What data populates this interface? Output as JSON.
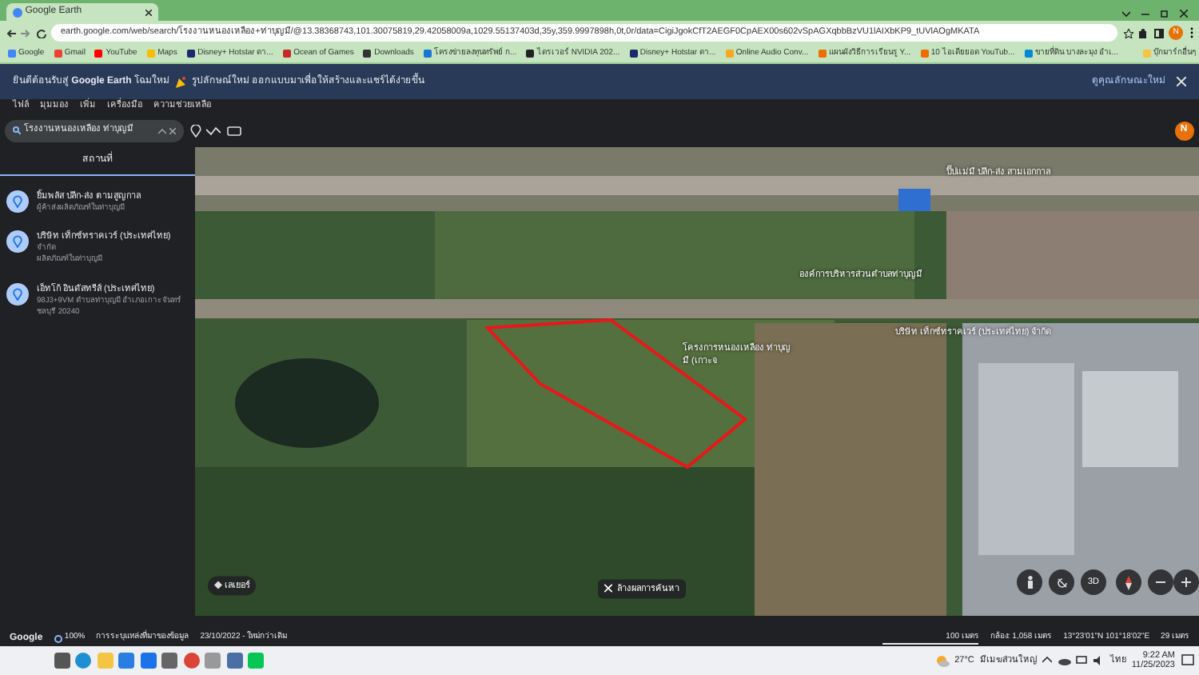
{
  "browser": {
    "tab_title": "Google Earth",
    "url": "earth.google.com/web/search/โรงงานหนองเหลือง+ท่าบุญมี/@13.38368743,101.30075819,29.42058009a,1029.55137403d,35y,359.9997898h,0t,0r/data=CigiJgokCfT2AEGF0CpAEX00s602vSpAGXqbbBzVU1lAIXbKP9_tUVlAOgMKATA",
    "profile_initial": "N",
    "bookmarks": [
      {
        "label": "Google",
        "color": "#4285f4"
      },
      {
        "label": "Gmail",
        "color": "#ea4335"
      },
      {
        "label": "YouTube",
        "color": "#ff0000"
      },
      {
        "label": "Maps",
        "color": "#fbbc04"
      },
      {
        "label": "Disney+ Hotstar ดา...",
        "color": "#1a2a6c"
      },
      {
        "label": "Ocean of Games",
        "color": "#c62828"
      },
      {
        "label": "Downloads",
        "color": "#333333"
      },
      {
        "label": "โครงข่ายลงทุนทรัพย์ ก...",
        "color": "#1976d2"
      },
      {
        "label": "ไดรเวอร์ NVIDIA 202...",
        "color": "#222222"
      },
      {
        "label": "Disney+ Hotstar ดา...",
        "color": "#1a2a6c"
      },
      {
        "label": "Online Audio Conv...",
        "color": "#f9a825"
      },
      {
        "label": "แผนผังวิธีการเรียนรู Y...",
        "color": "#ef6c00"
      },
      {
        "label": "10 ไอเดียยอด YouTub...",
        "color": "#ef6c00"
      },
      {
        "label": "ขายที่ดิน บางละมุง อำเ...",
        "color": "#0288d1"
      }
    ],
    "other_bookmarks": "บุ๊กมาร์กอื่นๆ"
  },
  "banner": {
    "welcome": "ยินดีต้อนรับสู่ **Google Earth** โฉมใหม่",
    "feature": "รูปลักษณ์ใหม่ ออกแบบมาเพื่อให้สร้างและแชร์ได้ง่ายขึ้น",
    "link": "ดูคุณลักษณะใหม่"
  },
  "menu": [
    "ไฟล์",
    "มุมมอง",
    "เพิ่ม",
    "เครื่องมือ",
    "ความช่วยเหลือ"
  ],
  "search": {
    "value": "โรงงานหนองเหลือง ท่าบุญมี"
  },
  "earth_profile_initial": "N",
  "sidebar": {
    "heading": "สถานที่",
    "places": [
      {
        "name": "ยิ้มพลัส ปลีก-ส่ง ตามสูญกาล",
        "lines": [
          "ผู้ค้าส่งผลิตภัณฑ์ในท่าบุญมี"
        ]
      },
      {
        "name": "บริษัท เท็กซ์ทราคเวร์ (ประเทศไทย)",
        "lines": [
          "จำกัด",
          "ผลิตภัณฑ์ในท่าบุญมี"
        ]
      },
      {
        "name": "เอ็ทโก้ อินดัสทรีส์ (ประเทศไทย)",
        "lines": [
          "98J3+9VM ตำบลท่าบุญมี อำเภอเกาะจันทร์",
          "ชลบุรี 20240"
        ]
      }
    ]
  },
  "map": {
    "labels": [
      "ปิ๊ปแม่มี ปลีก-ส่ง สามเอกกาล",
      "องค์การบริหารส่วนตำบลท่าบุญมี",
      "โครงการหนองเหลือง ท่าบุญมี (เกาะจ",
      "บริษัท เท็กซ์ทราคเวร์ (ประเทศไทย) จำกัด"
    ],
    "layers_button": "เลเยอร์",
    "clear_chip": "ล้างผลการค้นหา",
    "view_3d": "3D"
  },
  "status_bar": {
    "brand": "Google",
    "zoom": "100%",
    "attribution": "การระบุแหล่งที่มาของข้อมูล",
    "date": "23/10/2022 - ใหม่กว่าเดิม",
    "scale": "100 เมตร",
    "camera": "กล้อง: 1,058 เมตร",
    "coords": "13°23'01\"N 101°18'02\"E",
    "elevation": "29 เมตร"
  },
  "taskbar": {
    "temperature": "27°C",
    "weather": "มีเมฆส่วนใหญ่",
    "language": "ไทย",
    "time": "9:22 AM",
    "date": "11/25/2023"
  }
}
